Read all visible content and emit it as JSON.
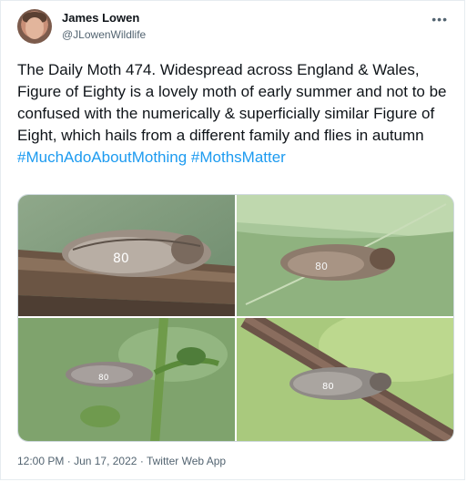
{
  "tweet": {
    "author_name": "James Lowen",
    "author_handle": "@JLowenWildlife",
    "more_icon": "ellipsis-icon",
    "text_body": "The Daily Moth 474. Widespread across England & Wales, Figure of Eighty is a lovely moth of early summer and not to be confused with the numerically & superficially similar Figure of Eight, which hails from a different family and flies in autumn",
    "hashtags": [
      "#MuchAdoAboutMothing",
      "#MothsMatter"
    ],
    "time": "12:00 PM",
    "date": "Jun 17, 2022",
    "separator": "·",
    "app": "Twitter Web App"
  }
}
